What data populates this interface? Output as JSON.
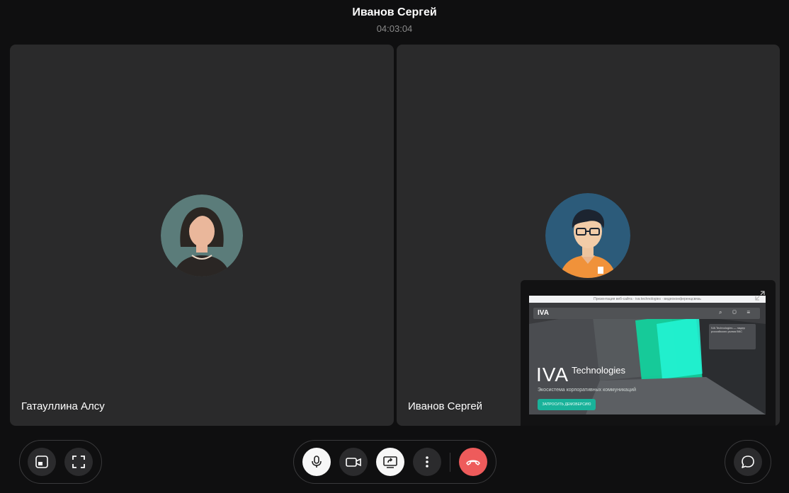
{
  "header": {
    "title": "Иванов Сергей",
    "timer": "04:03:04"
  },
  "tiles": [
    {
      "name": "Гатауллина Алсу",
      "avatar": "female-avatar"
    },
    {
      "name": "Иванов Сергей",
      "avatar": "male-avatar-glasses"
    }
  ],
  "screen_share": {
    "top_banner": "Презентация веб-сайта · iva technologies · видеоконференцсвязь",
    "logo_small": "IVA",
    "nav_icons": "⌕ ⚇ ≡",
    "card_text": "IVA Technologies — лидер российского рынка ВКС",
    "brand": "IVA",
    "brand_suffix": "Technologies",
    "subtitle": "Экосистема корпоративных коммуникаций",
    "cta": "ЗАПРОСИТЬ ДЕМОВЕРСИЮ"
  },
  "toolbar": {
    "left": [
      "layout-icon",
      "fullscreen-icon"
    ],
    "center": [
      "microphone-icon",
      "camera-icon",
      "screen-share-icon",
      "more-icon",
      "hangup-icon"
    ],
    "right": [
      "chat-icon"
    ]
  },
  "colors": {
    "background": "#0f0f10",
    "tile": "#2a2a2b",
    "hangup": "#ee5b5b",
    "accent": "#19b29a"
  }
}
